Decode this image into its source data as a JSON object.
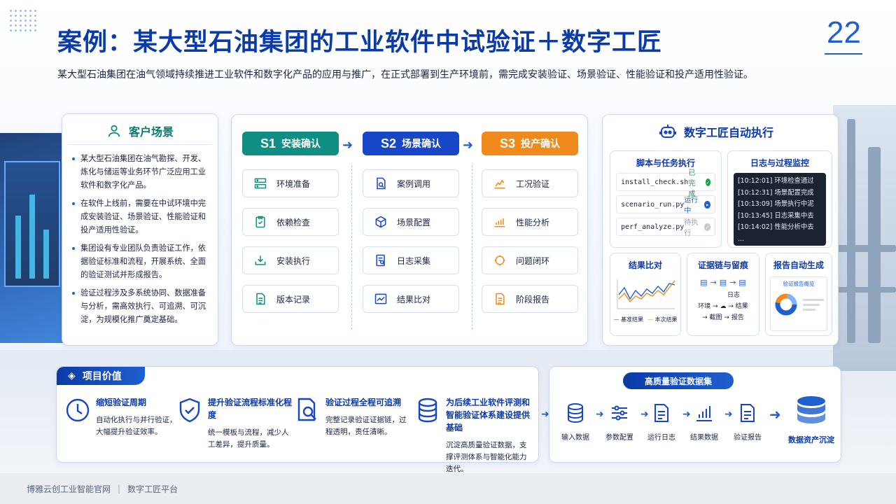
{
  "title": "案例：某大型石油集团的工业软件中试验证＋数字工匠",
  "page_number": "22",
  "subtitle": "某大型石油集团在油气领域持续推进工业软件和数字化产品的应用与推广，在正式部署到生产环境前，需完成安装验证、场景验证、性能验证和投产适用性验证。",
  "scene": {
    "title": "客户场景",
    "icon": "user-icon",
    "bullets": [
      "某大型石油集团在油气勘探、开发、炼化与储运等业务环节广泛应用工业软件和数字化产品。",
      "在软件上线前，需要在中试环境中完成安装验证、场景验证、性能验证和投产适用性验证。",
      "集团设有专业团队负责验证工作，依据验证标准和流程，开展系统、全面的验证测试并形成报告。",
      "验证过程涉及多系统协同、数据准备与分析，需高效执行、可追溯、可沉淀，为规模化推广奠定基础。"
    ]
  },
  "stages": [
    {
      "code": "S1",
      "name": "安装确认",
      "color": "#0f8f84",
      "steps": [
        {
          "label": "环境准备",
          "icon": "server-icon"
        },
        {
          "label": "依赖检查",
          "icon": "checklist-icon"
        },
        {
          "label": "安装执行",
          "icon": "download-icon"
        },
        {
          "label": "版本记录",
          "icon": "document-icon"
        }
      ]
    },
    {
      "code": "S2",
      "name": "场景确认",
      "color": "#1747c8",
      "steps": [
        {
          "label": "案例调用",
          "icon": "doc-search-icon"
        },
        {
          "label": "场景配置",
          "icon": "cube-icon"
        },
        {
          "label": "日志采集",
          "icon": "log-search-icon"
        },
        {
          "label": "结果比对",
          "icon": "chart-check-icon"
        }
      ]
    },
    {
      "code": "S3",
      "name": "投产确认",
      "color": "#f08a1c",
      "steps": [
        {
          "label": "工况验证",
          "icon": "line-chart-icon"
        },
        {
          "label": "性能分析",
          "icon": "bar-chart-icon"
        },
        {
          "label": "问题闭环",
          "icon": "loop-icon"
        },
        {
          "label": "阶段报告",
          "icon": "report-icon"
        }
      ]
    }
  ],
  "auto": {
    "title": "数字工匠自动执行",
    "scripts": {
      "title": "脚本与任务执行",
      "tasks": [
        {
          "name": "install_check.sh",
          "status": "已完成",
          "color": "#17a34a"
        },
        {
          "name": "scenario_run.py",
          "status": "运行中",
          "color": "#1f5fd0"
        },
        {
          "name": "perf_analyze.py",
          "status": "待执行",
          "color": "#9aa4b2"
        }
      ]
    },
    "logs": {
      "title": "日志与过程监控",
      "lines": [
        "[10:12:01] 环境检查通过",
        "[10:12:31] 场景配置完成",
        "[10:13:09] 场景执行中泥",
        "[10:13:45] 日志采集中去",
        "[10:14:02] 性能分析中去",
        "..."
      ]
    },
    "compare": {
      "title": "结果比对",
      "legend": [
        "基准结果",
        "本次结果"
      ]
    },
    "evidence": {
      "title": "证据链与留痕",
      "labels": [
        "环境",
        "日志",
        "结果",
        "截图",
        "报告"
      ]
    },
    "report": {
      "title": "报告自动生成",
      "inner": "验证报告概览"
    }
  },
  "value": {
    "title": "项目价值",
    "items": [
      {
        "title": "缩短验证周期",
        "desc": "自动化执行与并行验证，大幅提升验证效率。",
        "icon": "clock-icon"
      },
      {
        "title": "提升验证流程标准化程度",
        "desc": "统一模板与流程，减少人工差异，提升质量。",
        "icon": "shield-check-icon"
      },
      {
        "title": "验证过程全程可追溯",
        "desc": "完整记录验证证据链，过程透明，责任清晰。",
        "icon": "search-doc-icon"
      },
      {
        "title": "为后续工业软件评测和智能验证体系建设提供基础",
        "desc": "沉淀高质量验证数据，支撑评测体系与智能化能力迭代。",
        "icon": "database-icon"
      }
    ]
  },
  "dataset": {
    "title": "高质量验证数据集",
    "items": [
      {
        "label": "输入数据",
        "icon": "database-icon"
      },
      {
        "label": "参数配置",
        "icon": "sliders-icon"
      },
      {
        "label": "运行日志",
        "icon": "log-icon"
      },
      {
        "label": "结果数据",
        "icon": "bar-chart-icon"
      },
      {
        "label": "验证报告",
        "icon": "report-icon"
      }
    ],
    "final": {
      "label": "数据资产沉淀",
      "icon": "database-stack-icon"
    }
  },
  "footer": {
    "left": "博雅云创工业智能官网",
    "right": "数字工匠平台"
  }
}
